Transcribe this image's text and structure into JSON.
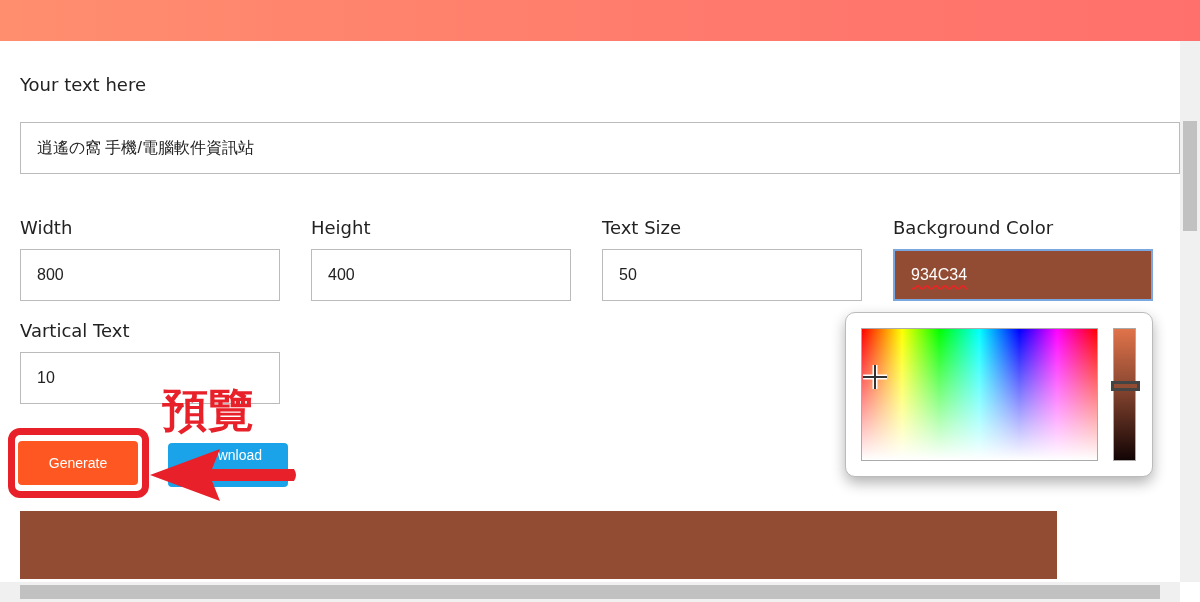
{
  "form": {
    "text_label": "Your text here",
    "text_value": "逍遙の窩  手機/電腦軟件資訊站",
    "fields": [
      {
        "label": "Width",
        "value": "800"
      },
      {
        "label": "Height",
        "value": "400"
      },
      {
        "label": "Text Size",
        "value": "50"
      },
      {
        "label": "Background Color",
        "value": "934C34",
        "kind": "color",
        "color": "#934c34"
      },
      {
        "label": "Vartical Text",
        "value": "10"
      }
    ],
    "buttons": [
      {
        "label": "Generate",
        "kind": "generate"
      },
      {
        "label": "wnload",
        "kind": "download"
      }
    ],
    "color_picker": {
      "level": 0.57
    },
    "preview": {
      "color": "#934c34"
    }
  },
  "annotation": {
    "text": "預覽"
  }
}
